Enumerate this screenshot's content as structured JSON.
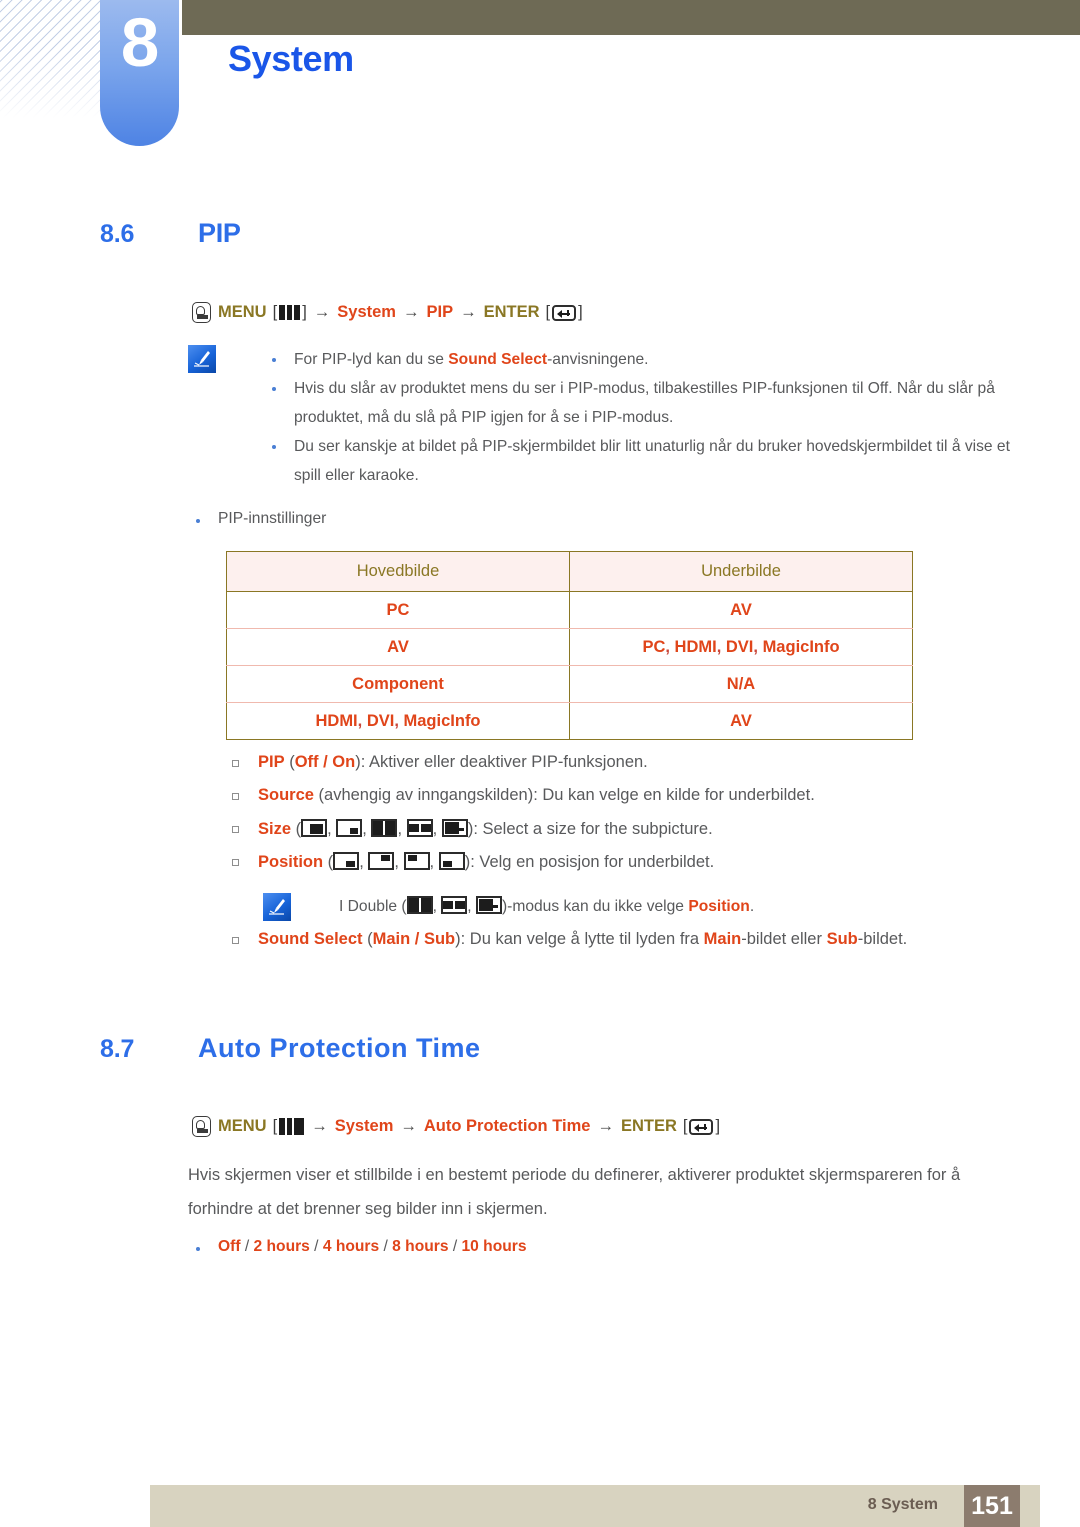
{
  "chapter": {
    "number": "8",
    "title": "System"
  },
  "sections": [
    {
      "number": "8.6",
      "title": "PIP",
      "menu_path": {
        "menu_label": "MENU",
        "enter_label": "ENTER",
        "nodes": [
          "System",
          "PIP"
        ],
        "arrow": "→",
        "bracket_open": "[",
        "bracket_close": "]",
        "menu_icon": "menu-button-icon",
        "bars_icon": "menu-bars-icon",
        "enter_icon": "enter-key-icon"
      },
      "notes": [
        {
          "pre": "For PIP-lyd kan du se ",
          "highlight": "Sound Select",
          "post": "-anvisningene."
        },
        {
          "pre": "Hvis du slår av produktet mens du ser i PIP-modus, tilbakestilles PIP-funksjonen til Off. Når du slår på produktet, må du slå på PIP igjen for å se i PIP-modus.",
          "highlight": "",
          "post": ""
        },
        {
          "pre": "Du ser kanskje at bildet på PIP-skjermbildet blir litt unaturlig når du bruker hovedskjermbildet til å vise et spill eller karaoke.",
          "highlight": "",
          "post": ""
        }
      ],
      "settings_bullet": "PIP-innstillinger",
      "table": {
        "headers": [
          "Hovedbilde",
          "Underbilde"
        ],
        "rows": [
          [
            "PC",
            "AV"
          ],
          [
            "AV",
            "PC, HDMI, DVI, MagicInfo"
          ],
          [
            "Component",
            "N/A"
          ],
          [
            "HDMI, DVI, MagicInfo",
            "AV"
          ]
        ]
      },
      "options": [
        {
          "name": "PIP",
          "values_open": " (",
          "values": "Off / On",
          "values_close": ")",
          "desc": ": Aktiver eller deaktiver PIP-funksjonen."
        },
        {
          "name": "Source",
          "values_open": " (",
          "values": "avhengig av inngangskilden",
          "values_close": ")",
          "desc": ": Du kan velge en kilde for underbildet."
        },
        {
          "name": "Size",
          "values_open": " (",
          "values": "",
          "values_close": ")",
          "desc": ": Select a size for the subpicture.",
          "icons": [
            "pip-size-bottom-right-large",
            "pip-size-bottom-right-small",
            "pip-size-double-split",
            "pip-size-double-wide",
            "pip-size-double-dash"
          ]
        },
        {
          "name": "Position",
          "values_open": " (",
          "values": "",
          "values_close": ")",
          "desc": ": Velg en posisjon for underbildet.",
          "icons": [
            "pip-position-bottom-right",
            "pip-position-top-right",
            "pip-position-top-left",
            "pip-position-bottom-left"
          ]
        },
        {
          "name": "Sound Select",
          "values_open": " (",
          "values": "Main / Sub",
          "values_close": ")",
          "desc": ": Du kan velge å lytte til lyden fra Main-bildet eller Sub-bildet.",
          "inline_highlights": [
            "Main",
            "Sub"
          ]
        }
      ],
      "double_note": {
        "pre": "I Double (",
        "mid": ")-modus kan du ikke velge ",
        "highlight": "Position",
        "post": ".",
        "icons": [
          "pip-size-double-split",
          "pip-size-double-wide",
          "pip-size-double-dash"
        ]
      }
    },
    {
      "number": "8.7",
      "title": "Auto Protection Time",
      "menu_path": {
        "menu_label": "MENU",
        "enter_label": "ENTER",
        "nodes": [
          "System",
          "Auto Protection Time"
        ],
        "arrow": "→",
        "bracket_open": "[",
        "bracket_close": "]"
      },
      "paragraph": "Hvis skjermen viser et stillbilde i en bestemt periode du definerer, aktiverer produktet skjermspareren for å forhindre at det brenner seg bilder inn i skjermen.",
      "values_bullet": {
        "parts": [
          "Off",
          "2 hours",
          "4 hours",
          "8 hours",
          "10 hours"
        ],
        "separator": " / "
      }
    }
  ],
  "footer": {
    "label": "8 System",
    "page_number": "151"
  },
  "colors": {
    "heading_blue": "#2d6ee8",
    "accent_red": "#e0451a",
    "menu_olive": "#8a7724",
    "body_gray": "#58595b",
    "table_header_bg": "#fdf0ee",
    "footer_bg": "#d8d3c0",
    "page_badge_bg": "#8c7c6e",
    "olive_bar": "#6e6a55"
  }
}
